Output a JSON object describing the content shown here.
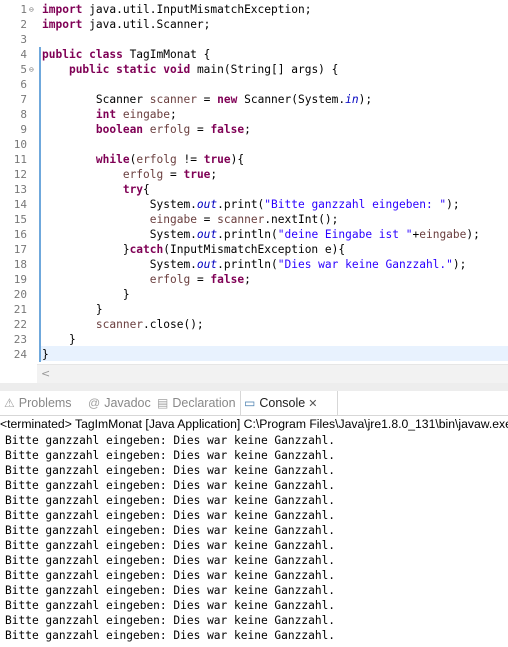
{
  "editor": {
    "lines": [
      {
        "num": "1",
        "fold": "⊖",
        "changed": false,
        "tokens": [
          {
            "c": "kw",
            "t": "import"
          },
          {
            "c": "",
            "t": " java.util.InputMismatchException;"
          }
        ]
      },
      {
        "num": "2",
        "fold": "",
        "changed": false,
        "tokens": [
          {
            "c": "kw",
            "t": "import"
          },
          {
            "c": "",
            "t": " java.util.Scanner;"
          }
        ]
      },
      {
        "num": "3",
        "fold": "",
        "changed": false,
        "tokens": []
      },
      {
        "num": "4",
        "fold": "",
        "changed": true,
        "tokens": [
          {
            "c": "kw",
            "t": "public class"
          },
          {
            "c": "",
            "t": " TagImMonat {"
          }
        ]
      },
      {
        "num": "5",
        "fold": "⊖",
        "changed": true,
        "tokens": [
          {
            "c": "",
            "t": "    "
          },
          {
            "c": "kw",
            "t": "public static void"
          },
          {
            "c": "",
            "t": " main(String[] args) {"
          }
        ]
      },
      {
        "num": "6",
        "fold": "",
        "changed": true,
        "tokens": []
      },
      {
        "num": "7",
        "fold": "",
        "changed": true,
        "tokens": [
          {
            "c": "",
            "t": "        Scanner "
          },
          {
            "c": "var",
            "t": "scanner"
          },
          {
            "c": "",
            "t": " = "
          },
          {
            "c": "kw",
            "t": "new"
          },
          {
            "c": "",
            "t": " Scanner(System."
          },
          {
            "c": "fld",
            "t": "in"
          },
          {
            "c": "",
            "t": ");"
          }
        ]
      },
      {
        "num": "8",
        "fold": "",
        "changed": true,
        "tokens": [
          {
            "c": "",
            "t": "        "
          },
          {
            "c": "kw",
            "t": "int"
          },
          {
            "c": "",
            "t": " "
          },
          {
            "c": "var",
            "t": "eingabe"
          },
          {
            "c": "",
            "t": ";"
          }
        ]
      },
      {
        "num": "9",
        "fold": "",
        "changed": true,
        "tokens": [
          {
            "c": "",
            "t": "        "
          },
          {
            "c": "kw",
            "t": "boolean"
          },
          {
            "c": "",
            "t": " "
          },
          {
            "c": "var",
            "t": "erfolg"
          },
          {
            "c": "",
            "t": " = "
          },
          {
            "c": "kw",
            "t": "false"
          },
          {
            "c": "",
            "t": ";"
          }
        ]
      },
      {
        "num": "10",
        "fold": "",
        "changed": true,
        "tokens": []
      },
      {
        "num": "11",
        "fold": "",
        "changed": true,
        "tokens": [
          {
            "c": "",
            "t": "        "
          },
          {
            "c": "kw",
            "t": "while"
          },
          {
            "c": "",
            "t": "("
          },
          {
            "c": "var",
            "t": "erfolg"
          },
          {
            "c": "",
            "t": " != "
          },
          {
            "c": "kw",
            "t": "true"
          },
          {
            "c": "",
            "t": "){"
          }
        ]
      },
      {
        "num": "12",
        "fold": "",
        "changed": true,
        "tokens": [
          {
            "c": "",
            "t": "            "
          },
          {
            "c": "var",
            "t": "erfolg"
          },
          {
            "c": "",
            "t": " = "
          },
          {
            "c": "kw",
            "t": "true"
          },
          {
            "c": "",
            "t": ";"
          }
        ]
      },
      {
        "num": "13",
        "fold": "",
        "changed": true,
        "tokens": [
          {
            "c": "",
            "t": "            "
          },
          {
            "c": "kw",
            "t": "try"
          },
          {
            "c": "",
            "t": "{"
          }
        ]
      },
      {
        "num": "14",
        "fold": "",
        "changed": true,
        "tokens": [
          {
            "c": "",
            "t": "                System."
          },
          {
            "c": "fld",
            "t": "out"
          },
          {
            "c": "",
            "t": ".print("
          },
          {
            "c": "str",
            "t": "\"Bitte ganzzahl eingeben: \""
          },
          {
            "c": "",
            "t": ");"
          }
        ]
      },
      {
        "num": "15",
        "fold": "",
        "changed": true,
        "tokens": [
          {
            "c": "",
            "t": "                "
          },
          {
            "c": "var",
            "t": "eingabe"
          },
          {
            "c": "",
            "t": " = "
          },
          {
            "c": "var",
            "t": "scanner"
          },
          {
            "c": "",
            "t": ".nextInt();"
          }
        ]
      },
      {
        "num": "16",
        "fold": "",
        "changed": true,
        "tokens": [
          {
            "c": "",
            "t": "                System."
          },
          {
            "c": "fld",
            "t": "out"
          },
          {
            "c": "",
            "t": ".println("
          },
          {
            "c": "str",
            "t": "\"deine Eingabe ist \""
          },
          {
            "c": "",
            "t": "+"
          },
          {
            "c": "var",
            "t": "eingabe"
          },
          {
            "c": "",
            "t": ");"
          }
        ]
      },
      {
        "num": "17",
        "fold": "",
        "changed": true,
        "tokens": [
          {
            "c": "",
            "t": "            }"
          },
          {
            "c": "kw",
            "t": "catch"
          },
          {
            "c": "",
            "t": "(InputMismatchException e){"
          }
        ]
      },
      {
        "num": "18",
        "fold": "",
        "changed": true,
        "tokens": [
          {
            "c": "",
            "t": "                System."
          },
          {
            "c": "fld",
            "t": "out"
          },
          {
            "c": "",
            "t": ".println("
          },
          {
            "c": "str",
            "t": "\"Dies war keine Ganzzahl.\""
          },
          {
            "c": "",
            "t": ");"
          }
        ]
      },
      {
        "num": "19",
        "fold": "",
        "changed": true,
        "tokens": [
          {
            "c": "",
            "t": "                "
          },
          {
            "c": "var",
            "t": "erfolg"
          },
          {
            "c": "",
            "t": " = "
          },
          {
            "c": "kw",
            "t": "false"
          },
          {
            "c": "",
            "t": ";"
          }
        ]
      },
      {
        "num": "20",
        "fold": "",
        "changed": true,
        "tokens": [
          {
            "c": "",
            "t": "            }"
          }
        ]
      },
      {
        "num": "21",
        "fold": "",
        "changed": true,
        "tokens": [
          {
            "c": "",
            "t": "        }"
          }
        ]
      },
      {
        "num": "22",
        "fold": "",
        "changed": true,
        "tokens": [
          {
            "c": "",
            "t": "        "
          },
          {
            "c": "var",
            "t": "scanner"
          },
          {
            "c": "",
            "t": ".close();"
          }
        ]
      },
      {
        "num": "23",
        "fold": "",
        "changed": true,
        "tokens": [
          {
            "c": "",
            "t": "    }"
          }
        ]
      },
      {
        "num": "24",
        "fold": "",
        "changed": true,
        "tokens": [
          {
            "c": "",
            "t": "}"
          }
        ]
      }
    ]
  },
  "hscroll": {
    "left_arrow": "<"
  },
  "tabs": [
    {
      "name": "tab-problems",
      "icon": "problems-icon",
      "glyph": "⚠",
      "label": "Problems",
      "active": false
    },
    {
      "name": "tab-javadoc",
      "icon": "javadoc-icon",
      "glyph": "@",
      "label": "Javadoc",
      "active": false
    },
    {
      "name": "tab-declaration",
      "icon": "declaration-icon",
      "glyph": "▤",
      "label": "Declaration",
      "active": false
    },
    {
      "name": "tab-console",
      "icon": "console-icon",
      "glyph": "▭",
      "label": "Console",
      "active": true,
      "close": "✕"
    }
  ],
  "console": {
    "header": "<terminated> TagImMonat [Java Application] C:\\Program Files\\Java\\jre1.8.0_131\\bin\\javaw.exe",
    "output_line": "Bitte ganzzahl eingeben: Dies war keine Ganzzahl.",
    "output_count": 14
  },
  "colors": {
    "keyword": "#7f0055",
    "string": "#2a00ff",
    "field": "#0000c0",
    "local_var": "#6a3e3e",
    "current_line": "#e8f2fe"
  }
}
